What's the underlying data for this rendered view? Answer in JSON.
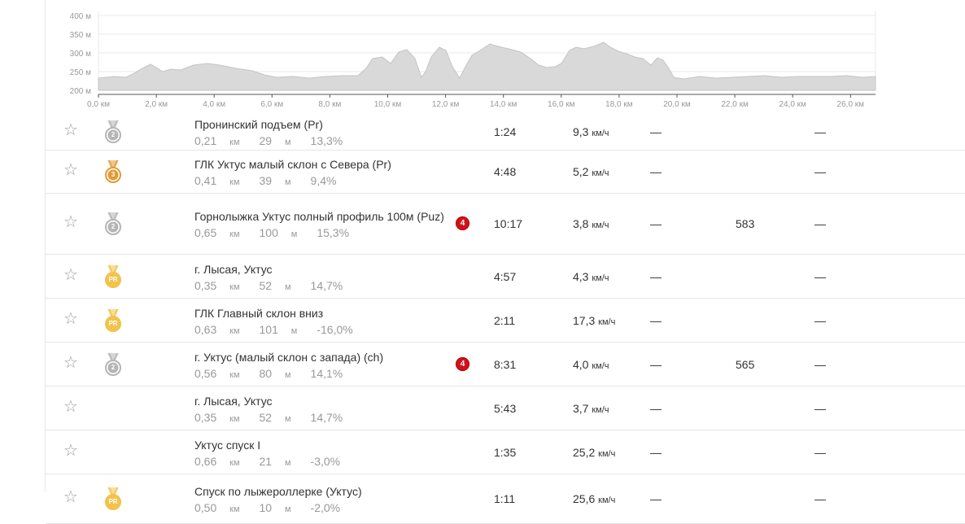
{
  "elevation": {
    "y_labels": [
      "400 м",
      "350 м",
      "300 м",
      "250 м",
      "200 м"
    ],
    "x_labels": [
      "0,0 км",
      "2,0 км",
      "4,0 км",
      "6,0 км",
      "8,0 км",
      "10,0 км",
      "12,0 км",
      "14,0 км",
      "16,0 км",
      "18,0 км",
      "20,0 км",
      "22,0 км",
      "24,0 км",
      "26,0 км"
    ]
  },
  "segments": [
    {
      "name": "Пронинский подъем (Pr)",
      "dist": "0,21",
      "dist_unit": "км",
      "elev": "29",
      "elev_unit": "м",
      "grade": "13,3%",
      "medal": "silver",
      "medal_text": "2",
      "badge": "",
      "time": "1:24",
      "speed": "9,3",
      "speed_unit": "км/ч",
      "col1": "—",
      "rank": "",
      "col2": "—"
    },
    {
      "name": "ГЛК Уктус малый склон с Севера (Pr)",
      "dist": "0,41",
      "dist_unit": "км",
      "elev": "39",
      "elev_unit": "м",
      "grade": "9,4%",
      "medal": "bronze",
      "medal_text": "3",
      "badge": "",
      "time": "4:48",
      "speed": "5,2",
      "speed_unit": "км/ч",
      "col1": "—",
      "rank": "",
      "col2": "—"
    },
    {
      "name": "Горнолыжка Уктус полный профиль 100м (Puz)",
      "dist": "0,65",
      "dist_unit": "км",
      "elev": "100",
      "elev_unit": "м",
      "grade": "15,3%",
      "medal": "silver",
      "medal_text": "2",
      "badge": "4",
      "time": "10:17",
      "speed": "3,8",
      "speed_unit": "км/ч",
      "col1": "—",
      "rank": "583",
      "col2": "—"
    },
    {
      "name": "г. Лысая, Уктус",
      "dist": "0,35",
      "dist_unit": "км",
      "elev": "52",
      "elev_unit": "м",
      "grade": "14,7%",
      "medal": "pr",
      "medal_text": "PR",
      "badge": "",
      "time": "4:57",
      "speed": "4,3",
      "speed_unit": "км/ч",
      "col1": "—",
      "rank": "",
      "col2": "—"
    },
    {
      "name": "ГЛК Главный склон вниз",
      "dist": "0,63",
      "dist_unit": "км",
      "elev": "101",
      "elev_unit": "м",
      "grade": "-16,0%",
      "medal": "pr",
      "medal_text": "PR",
      "badge": "",
      "time": "2:11",
      "speed": "17,3",
      "speed_unit": "км/ч",
      "col1": "—",
      "rank": "",
      "col2": "—"
    },
    {
      "name": "г. Уктус (малый склон с запада) (ch)",
      "dist": "0,56",
      "dist_unit": "км",
      "elev": "80",
      "elev_unit": "м",
      "grade": "14,1%",
      "medal": "silver",
      "medal_text": "2",
      "badge": "4",
      "time": "8:31",
      "speed": "4,0",
      "speed_unit": "км/ч",
      "col1": "—",
      "rank": "565",
      "col2": "—"
    },
    {
      "name": "г. Лысая, Уктус",
      "dist": "0,35",
      "dist_unit": "км",
      "elev": "52",
      "elev_unit": "м",
      "grade": "14,7%",
      "medal": "",
      "medal_text": "",
      "badge": "",
      "time": "5:43",
      "speed": "3,7",
      "speed_unit": "км/ч",
      "col1": "—",
      "rank": "",
      "col2": "—"
    },
    {
      "name": "Уктус спуск I",
      "dist": "0,66",
      "dist_unit": "км",
      "elev": "21",
      "elev_unit": "м",
      "grade": "-3,0%",
      "medal": "",
      "medal_text": "",
      "badge": "",
      "time": "1:35",
      "speed": "25,2",
      "speed_unit": "км/ч",
      "col1": "—",
      "rank": "",
      "col2": "—"
    },
    {
      "name": "Спуск по лыжероллерке (Уктус)",
      "dist": "0,50",
      "dist_unit": "км",
      "elev": "10",
      "elev_unit": "м",
      "grade": "-2,0%",
      "medal": "pr",
      "medal_text": "PR",
      "badge": "",
      "time": "1:11",
      "speed": "25,6",
      "speed_unit": "км/ч",
      "col1": "—",
      "rank": "",
      "col2": "—"
    }
  ],
  "icons": {
    "star": "star-outline-icon",
    "medal": "achievement-medal-icon",
    "badge": "kom-rank-badge"
  },
  "colors": {
    "badge": "#d0121b",
    "silver": "#b5b5b5",
    "bronze": "#e29a35",
    "pr": "#f3c24b",
    "area": "#d9d9d9",
    "area_line": "#c4c4c4"
  }
}
